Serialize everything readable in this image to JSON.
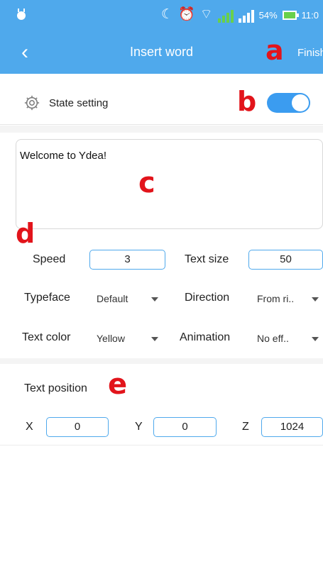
{
  "status_bar": {
    "battery_percent": "54%",
    "time": "11:0"
  },
  "header": {
    "title": "Insert word",
    "finish_label": "Finish"
  },
  "markers": {
    "a": "a",
    "b": "b",
    "c": "c",
    "d": "d",
    "e": "e"
  },
  "state_setting": {
    "label": "State setting",
    "toggle_on": true,
    "toggle_color": "#3b9cf0"
  },
  "text_content": "Welcome to Ydea!",
  "params": {
    "speed_label": "Speed",
    "speed_value": "3",
    "text_size_label": "Text size",
    "text_size_value": "50",
    "typeface_label": "Typeface",
    "typeface_value": "Default",
    "direction_label": "Direction",
    "direction_value": "From ri..",
    "text_color_label": "Text color",
    "text_color_value": "Yellow",
    "animation_label": "Animation",
    "animation_value": "No eff.."
  },
  "text_position": {
    "title": "Text position",
    "x_label": "X",
    "x_value": "0",
    "y_label": "Y",
    "y_value": "0",
    "z_label": "Z",
    "z_value": "1024"
  },
  "colors": {
    "header_blue": "#4fa9ec",
    "marker_red": "#e2141b"
  }
}
